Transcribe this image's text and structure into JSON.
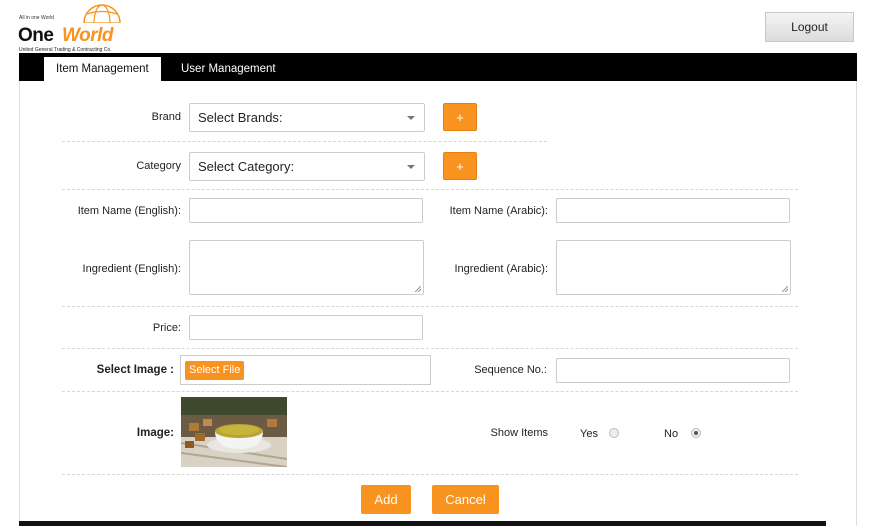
{
  "brand": {
    "tagline": "All in one World",
    "name_part1": "One",
    "name_part2": "World",
    "subtitle": "United General Trading & Contracting Co."
  },
  "header": {
    "logout_label": "Logout"
  },
  "tabs": [
    {
      "label": "Item Management"
    },
    {
      "label": "User Management"
    }
  ],
  "form": {
    "brand_label": "Brand",
    "brand_select": "Select Brands:",
    "category_label": "Category",
    "category_select": "Select Category:",
    "add_symbol": "+",
    "item_name_en_label": "Item Name (English):",
    "item_name_ar_label": "Item Name (Arabic):",
    "ingredient_en_label": "Ingredient (English):",
    "ingredient_ar_label": "Ingredient (Arabic):",
    "price_label": "Price:",
    "select_image_label": "Select Image :",
    "select_file_label": "Select File",
    "sequence_label": "Sequence No.:",
    "image_label": "Image:",
    "show_items_label": "Show Items",
    "yes_label": "Yes",
    "no_label": "No",
    "show_items_selected": "No"
  },
  "actions": {
    "add_label": "Add",
    "cancel_label": "Cancel"
  },
  "colors": {
    "accent": "#f7931e",
    "tabbar": "#000000"
  }
}
